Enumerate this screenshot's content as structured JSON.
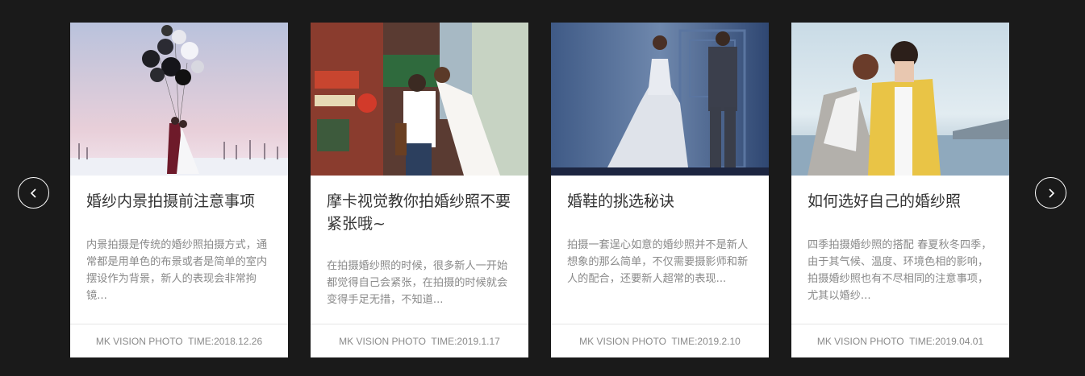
{
  "carousel": {
    "prev_icon": "chevron-left-icon",
    "next_icon": "chevron-right-icon",
    "cards": [
      {
        "title": "婚纱内景拍摄前注意事项",
        "excerpt": "内景拍摄是传统的婚纱照拍摄方式，通常都是用单色的布景或者是简单的室内摆设作为背景，新人的表现会非常拘镜...",
        "meta": "MK VISION PHOTO  TIME:2018.12.26"
      },
      {
        "title": "摩卡视觉教你拍婚纱照不要紧张哦~",
        "excerpt": "在拍摄婚纱照的时候，很多新人一开始都觉得自己会紧张，在拍摄的时候就会变得手足无措，不知道...",
        "meta": "MK VISION PHOTO  TIME:2019.1.17"
      },
      {
        "title": "婚鞋的挑选秘诀",
        "excerpt": "拍摄一套逞心如意的婚纱照并不是新人想象的那么简单，不仅需要摄影师和新人的配合，还要新人超常的表现...",
        "meta": "MK VISION PHOTO  TIME:2019.2.10"
      },
      {
        "title": "如何选好自己的婚纱照",
        "excerpt": "四季拍摄婚纱照的搭配 春夏秋冬四季，由于其气候、温度、环境色相的影响，拍摄婚纱照也有不尽相同的注意事项，尤其以婚纱...",
        "meta": "MK VISION PHOTO  TIME:2019.04.01"
      }
    ]
  },
  "colors": {
    "background": "#1a1a1a",
    "card": "#ffffff",
    "title": "#333333",
    "text": "#8a8a8a"
  }
}
